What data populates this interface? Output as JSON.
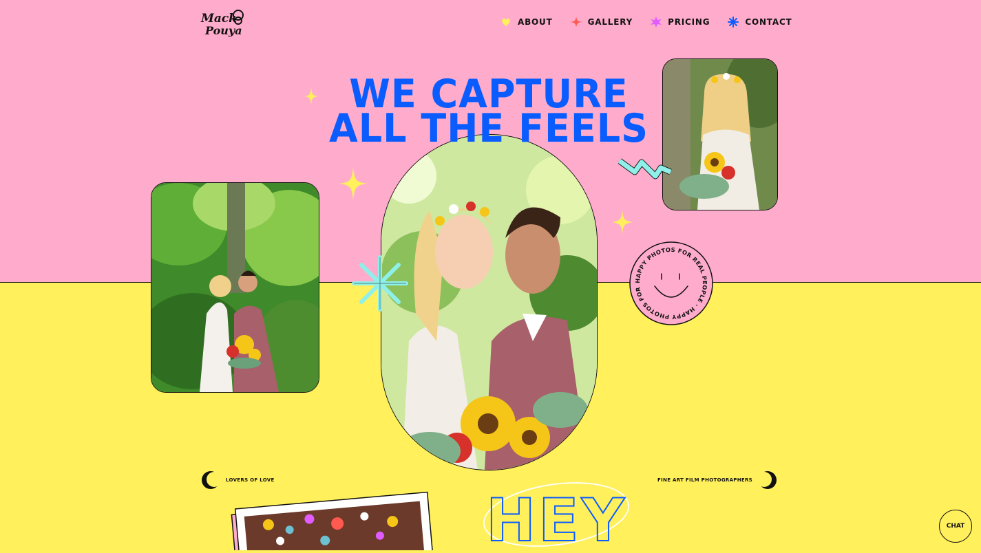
{
  "brand": {
    "logo_text": "Mack & Pouya",
    "logo_line1": "Mack",
    "logo_line2": "Pouya"
  },
  "nav": {
    "items": [
      {
        "label": "About",
        "icon": "heart-icon",
        "color": "#fff05c"
      },
      {
        "label": "Gallery",
        "icon": "sparkle-icon",
        "color": "#ff5a4f"
      },
      {
        "label": "Pricing",
        "icon": "star-icon",
        "color": "#e05cff"
      },
      {
        "label": "Contact",
        "icon": "asterisk-icon",
        "color": "#0a5cff"
      }
    ]
  },
  "hero": {
    "title_line1": "WE CAPTURE",
    "title_line2": "ALL THE FEELS"
  },
  "badge": {
    "ring_text": "HAPPY PHOTOS FOR REAL PEOPLE · HAPPY PHOTOS FOR REAL PEOPLE · ",
    "icon": "smiley-icon"
  },
  "taglines": {
    "left": "LOVERS OF LOVE",
    "right": "FINE ART FILM PHOTOGRAPHERS"
  },
  "intro": {
    "heading": "HEY"
  },
  "chat": {
    "label": "CHAT"
  },
  "colors": {
    "pink": "#ffaccc",
    "yellow": "#fff05c",
    "blue": "#0a5cff",
    "aqua": "#8ef0e8"
  }
}
